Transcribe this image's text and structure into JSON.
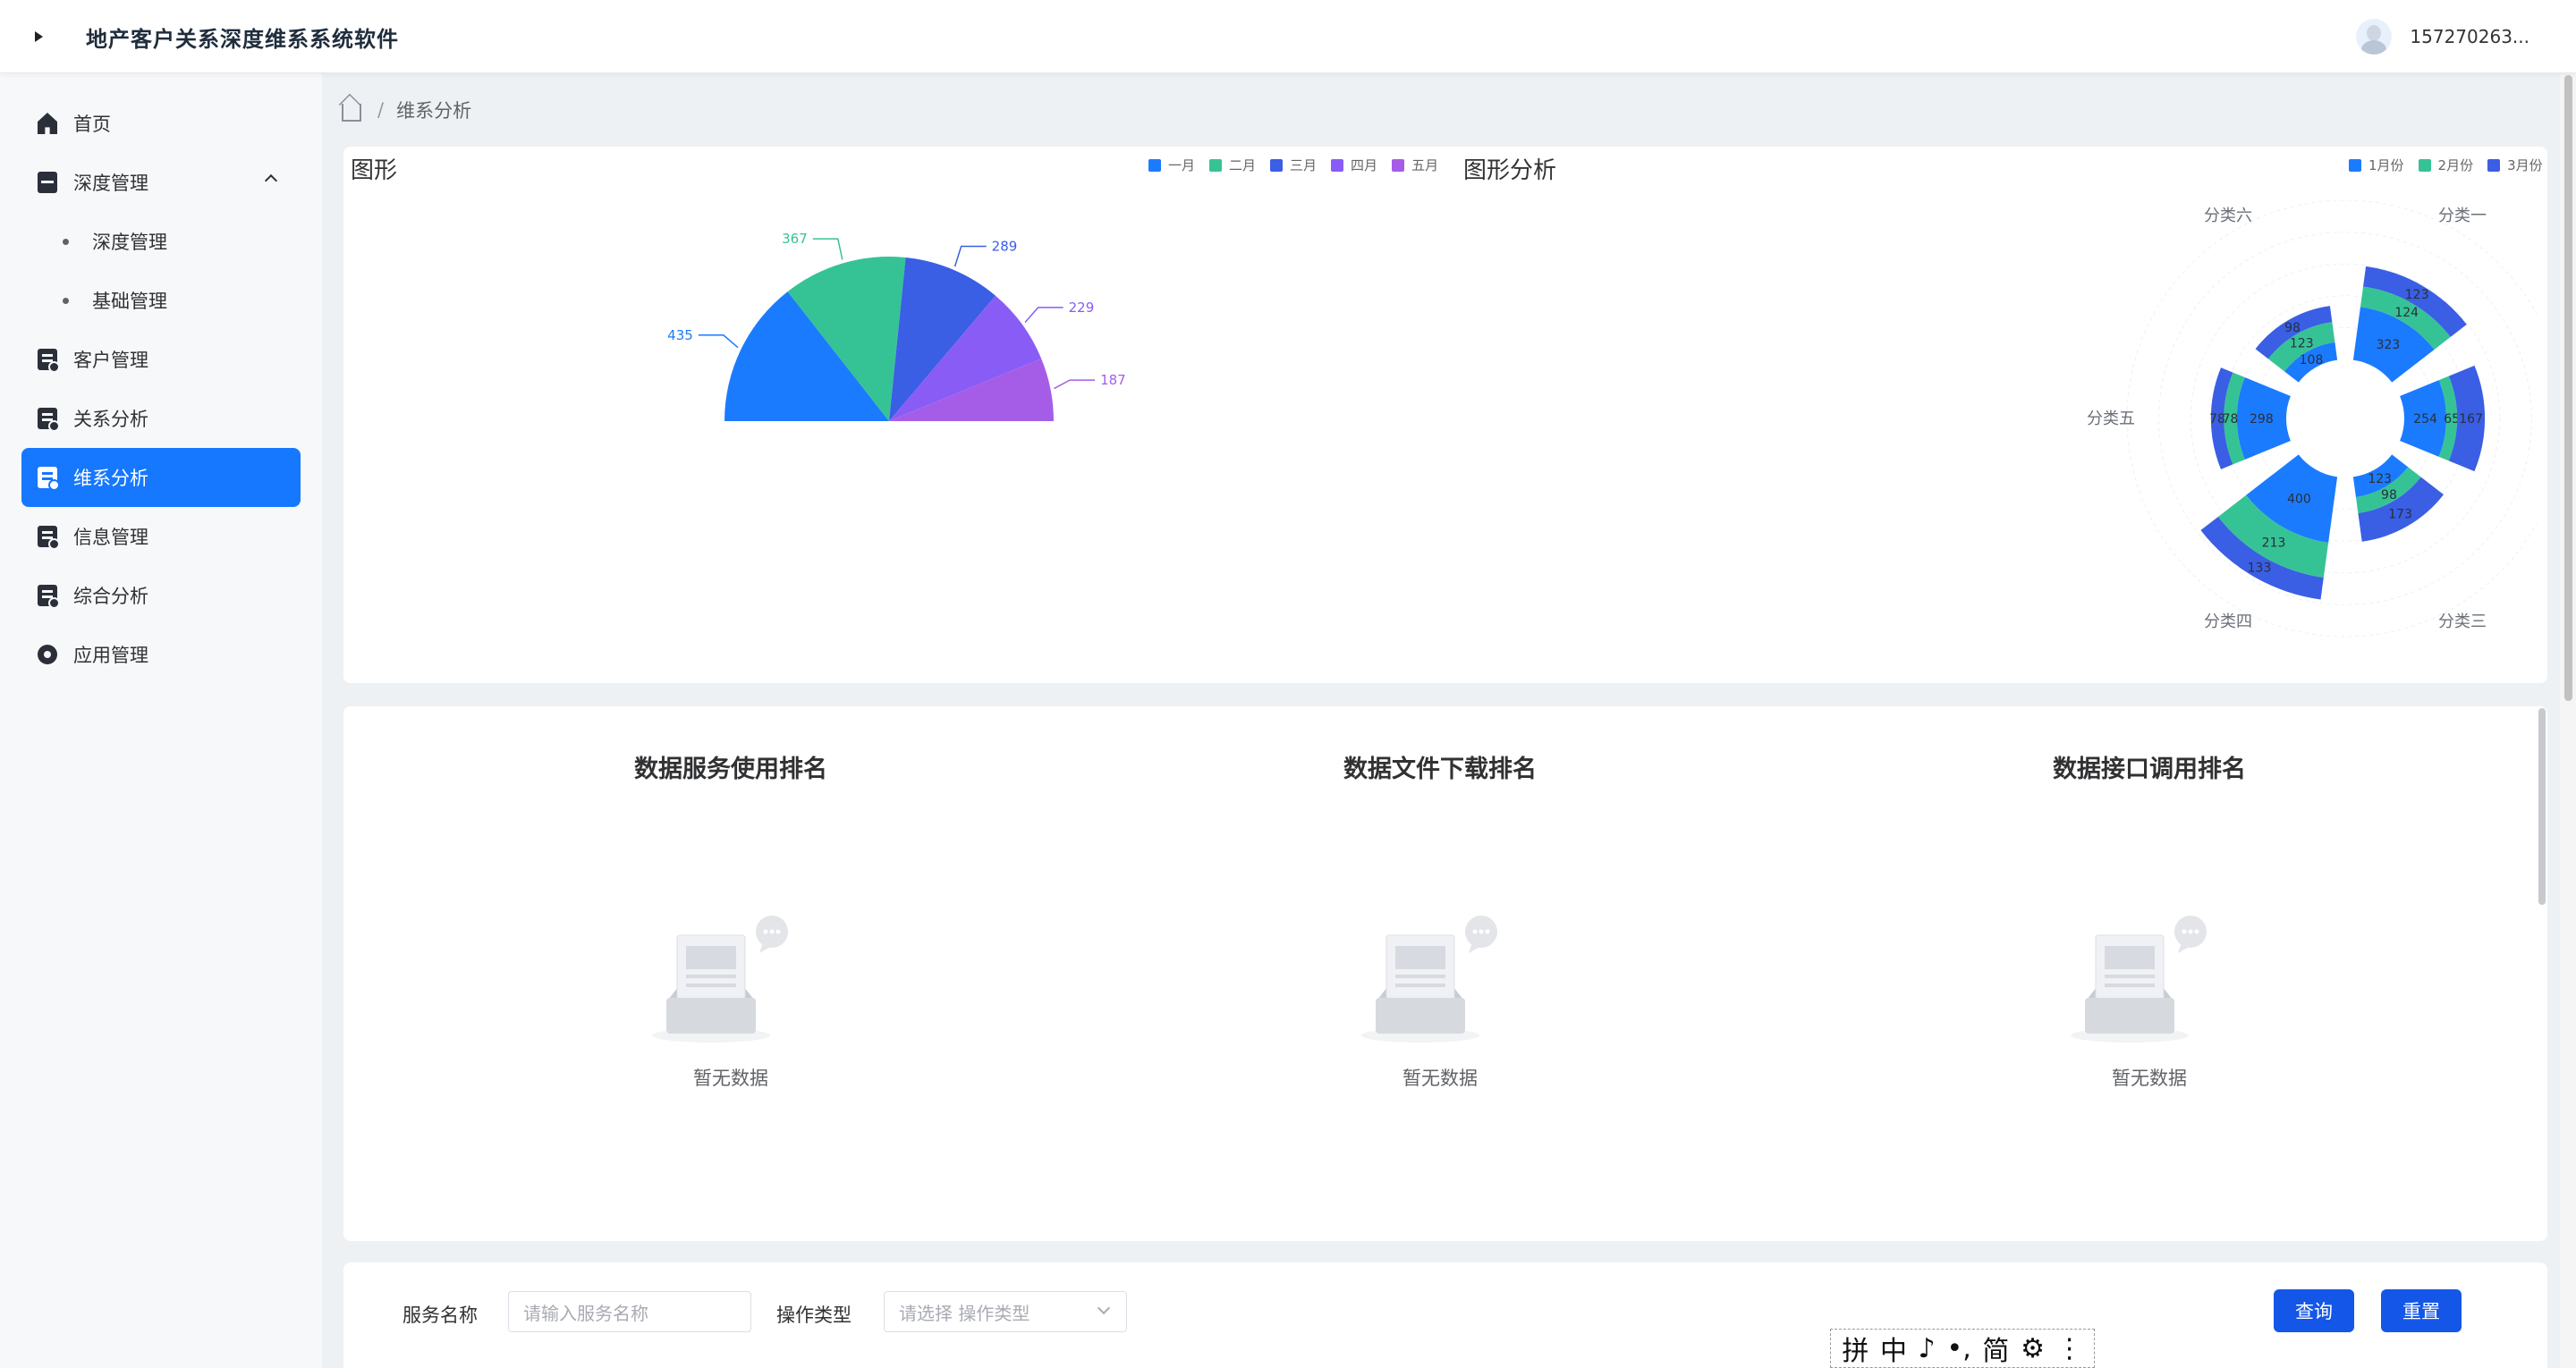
{
  "header": {
    "title": "地产客户关系深度维系系统软件",
    "user": "157270263..."
  },
  "sidebar": {
    "items": [
      {
        "label": "首页"
      },
      {
        "label": "深度管理"
      },
      {
        "label": "深度管理"
      },
      {
        "label": "基础管理"
      },
      {
        "label": "客户管理"
      },
      {
        "label": "关系分析"
      },
      {
        "label": "维系分析"
      },
      {
        "label": "信息管理"
      },
      {
        "label": "综合分析"
      },
      {
        "label": "应用管理"
      }
    ]
  },
  "breadcrumb": {
    "sep": "/",
    "current": "维系分析"
  },
  "chart_left": {
    "title": "图形"
  },
  "chart_right": {
    "title": "图形分析"
  },
  "chart_data": [
    {
      "type": "pie",
      "variant": "half-pie",
      "categories": [
        "一月",
        "二月",
        "三月",
        "四月",
        "五月"
      ],
      "values": [
        435,
        367,
        289,
        229,
        187
      ],
      "colors": [
        "#1b7bff",
        "#35c396",
        "#3a5ee4",
        "#8a5cf6",
        "#a55de8"
      ],
      "legend": "top-right"
    },
    {
      "type": "bar",
      "variant": "polar-stacked",
      "categories": [
        "分类一",
        "分类二",
        "分类三",
        "分类四",
        "分类五",
        "分类六"
      ],
      "series": [
        {
          "name": "1月份",
          "values": [
            323,
            254,
            123,
            400,
            298,
            108
          ],
          "color": "#1b7bff"
        },
        {
          "name": "2月份",
          "values": [
            124,
            65,
            98,
            213,
            78,
            123
          ],
          "color": "#35c396"
        },
        {
          "name": "3月份",
          "values": [
            123,
            167,
            173,
            133,
            78,
            98
          ],
          "color": "#3a5ee4"
        }
      ],
      "legend": "top-right"
    }
  ],
  "rankings": [
    {
      "title": "数据服务使用排名",
      "empty": "暂无数据"
    },
    {
      "title": "数据文件下载排名",
      "empty": "暂无数据"
    },
    {
      "title": "数据接口调用排名",
      "empty": "暂无数据"
    }
  ],
  "filter": {
    "service_label": "服务名称",
    "service_placeholder": "请输入服务名称",
    "type_label": "操作类型",
    "type_placeholder": "请选择 操作类型",
    "query_btn": "查询",
    "reset_btn": "重置"
  },
  "ime_bar": {
    "items": [
      "拼",
      "中",
      "♪",
      "•,",
      "简",
      "⚙",
      "⋮"
    ]
  }
}
